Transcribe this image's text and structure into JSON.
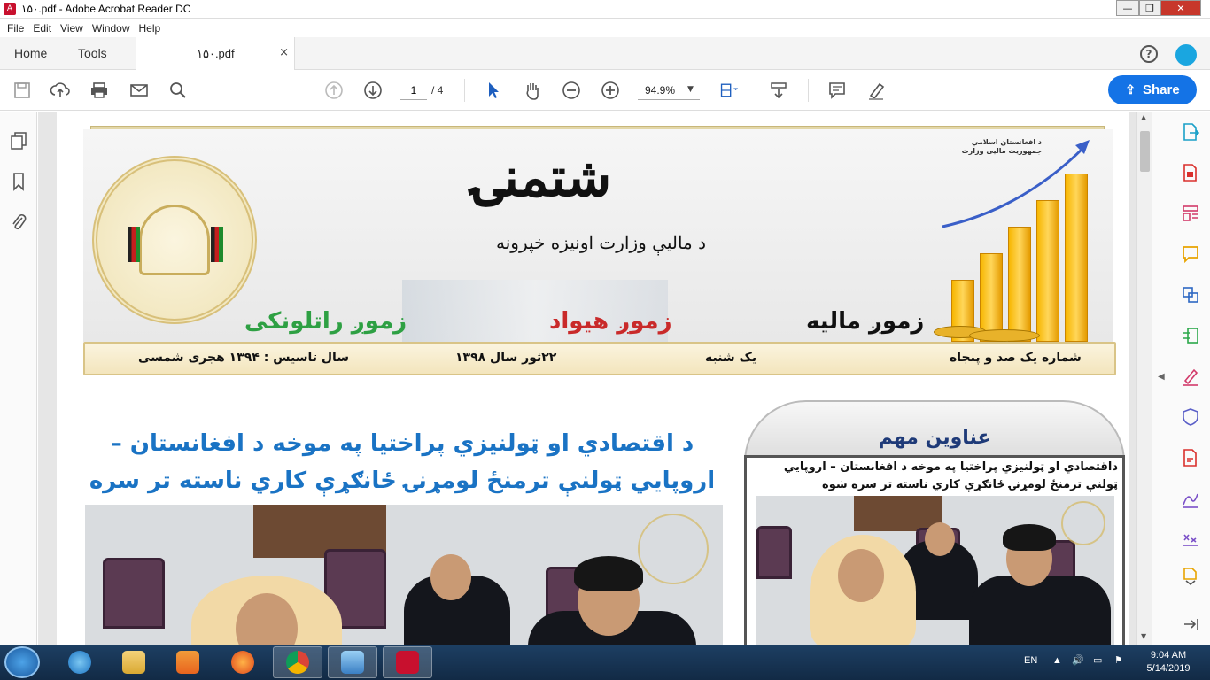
{
  "window": {
    "title": "۱۵۰.pdf - Adobe Acrobat Reader DC",
    "min_label": "—",
    "max_label": "❐",
    "close_label": "✕"
  },
  "menu": [
    "File",
    "Edit",
    "View",
    "Window",
    "Help"
  ],
  "tabs": {
    "home": "Home",
    "tools": "Tools",
    "document": "۱۵۰.pdf",
    "close": "×"
  },
  "toolbar": {
    "page_current": "1",
    "page_total": "/  4",
    "zoom": "94.9%",
    "share_label": "Share"
  },
  "document": {
    "ministry_tag": "د افغانستان اسلامي جمهوريت مالیې وزارت",
    "masthead": "شتمنۍ",
    "subhead": "د مالیې وزارت اونیزه خپرونه",
    "section_left": "زموږ راتلونکی",
    "section_middle": "زموږ هیواد",
    "section_right": "زموږ مالیه",
    "info": {
      "issue": "شماره یک صد و پنجاه",
      "day": "یک شنبه",
      "date": "۲۲ثور   سال ۱۳۹۸",
      "founded": "سال تاسیس : ۱۳۹۴ هجری شمسی"
    },
    "headline": "د اقتصادي او ټولنيزي پراختيا په موخه د افغانستان – اروپايي ټولنې ترمنځ لومړنۍ ځانګړې کاري ناسته تر سره شوه",
    "sidebox_title": "عناوین مهم",
    "sidebox_text": "داقتصادي او ټولنيزي پراختيا په موخه د افغانستان – اروپايي ټولنې ترمنځ لومړنۍ ځانګړې کاري ناسته تر سره شوه"
  },
  "taskbar": {
    "apps": [
      "internet-explorer",
      "file-explorer",
      "media-player",
      "firefox",
      "chrome",
      "picture-viewer",
      "acrobat-reader"
    ],
    "language": "EN",
    "time": "9:04 AM",
    "date": "5/14/2019"
  },
  "colors": {
    "share_button": "#1473e6",
    "headline": "#1a73c4",
    "section_left": "#2ea043",
    "section_middle": "#c92a2a",
    "acrobat_red": "#c8102e"
  }
}
